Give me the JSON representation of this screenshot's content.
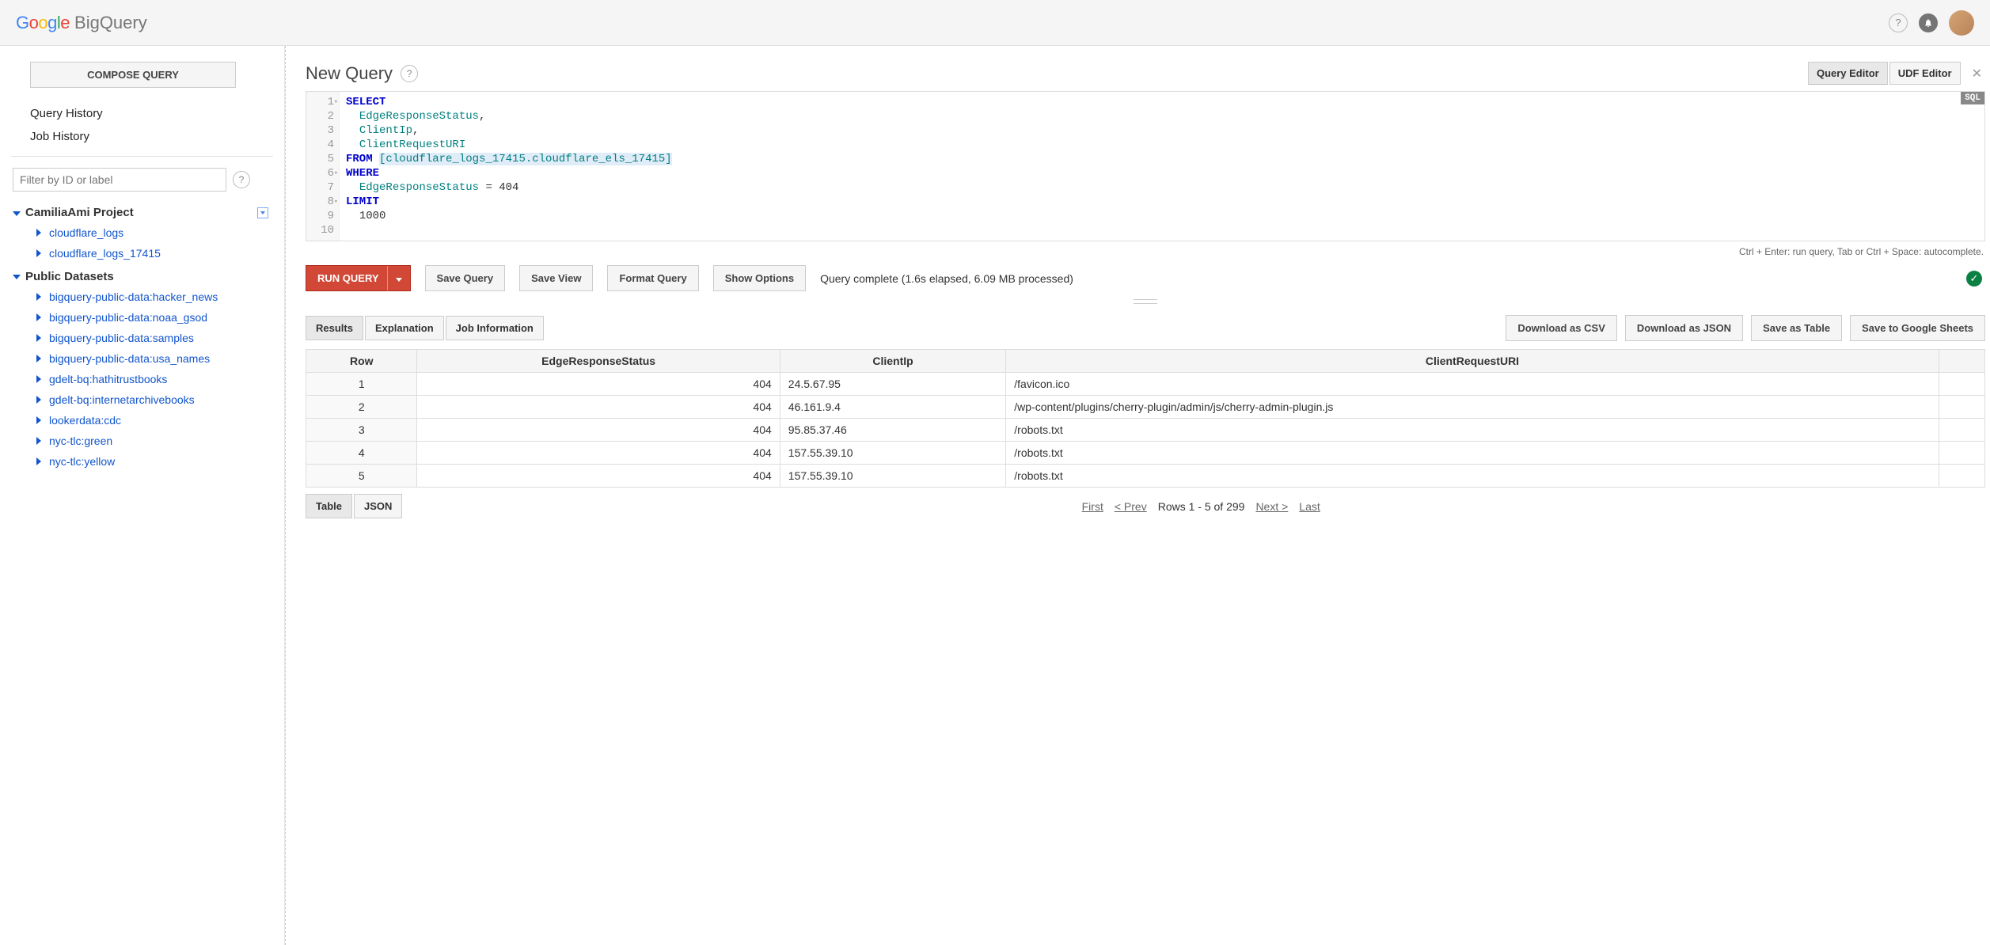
{
  "header": {
    "logo_google": "Google",
    "logo_bq": "BigQuery"
  },
  "sidebar": {
    "compose_label": "COMPOSE QUERY",
    "query_history": "Query History",
    "job_history": "Job History",
    "filter_placeholder": "Filter by ID or label",
    "project_name": "CamiliaAmi Project",
    "project_datasets": [
      {
        "label": "cloudflare_logs"
      },
      {
        "label": "cloudflare_logs_17415"
      }
    ],
    "public_label": "Public Datasets",
    "public_datasets": [
      {
        "label": "bigquery-public-data:hacker_news"
      },
      {
        "label": "bigquery-public-data:noaa_gsod"
      },
      {
        "label": "bigquery-public-data:samples"
      },
      {
        "label": "bigquery-public-data:usa_names"
      },
      {
        "label": "gdelt-bq:hathitrustbooks"
      },
      {
        "label": "gdelt-bq:internetarchivebooks"
      },
      {
        "label": "lookerdata:cdc"
      },
      {
        "label": "nyc-tlc:green"
      },
      {
        "label": "nyc-tlc:yellow"
      }
    ]
  },
  "query": {
    "title": "New Query",
    "tab_query_editor": "Query Editor",
    "tab_udf_editor": "UDF Editor",
    "sql_badge": "SQL",
    "lines": {
      "l1_kw": "SELECT",
      "l2_id": "EdgeResponseStatus",
      "l2_comma": ",",
      "l3_id": "ClientIp",
      "l3_comma": ",",
      "l4_id": "ClientRequestURI",
      "l5_kw": "FROM",
      "l5_tbl": "[cloudflare_logs_17415.cloudflare_els_17415]",
      "l6_kw": "WHERE",
      "l7_id": "EdgeResponseStatus",
      "l7_op": " = 404",
      "l8_kw": "LIMIT",
      "l9_val": "1000"
    },
    "hint": "Ctrl + Enter: run query, Tab or Ctrl + Space: autocomplete."
  },
  "actions": {
    "run": "RUN QUERY",
    "save_query": "Save Query",
    "save_view": "Save View",
    "format_query": "Format Query",
    "show_options": "Show Options",
    "status": "Query complete (1.6s elapsed, 6.09 MB processed)"
  },
  "results": {
    "tabs": {
      "results": "Results",
      "explanation": "Explanation",
      "job_info": "Job Information"
    },
    "exports": {
      "csv": "Download as CSV",
      "json": "Download as JSON",
      "save_table": "Save as Table",
      "save_sheets": "Save to Google Sheets"
    },
    "columns": [
      "Row",
      "EdgeResponseStatus",
      "ClientIp",
      "ClientRequestURI"
    ],
    "rows": [
      {
        "row": "1",
        "status": "404",
        "ip": "24.5.67.95",
        "uri": "/favicon.ico"
      },
      {
        "row": "2",
        "status": "404",
        "ip": "46.161.9.4",
        "uri": "/wp-content/plugins/cherry-plugin/admin/js/cherry-admin-plugin.js"
      },
      {
        "row": "3",
        "status": "404",
        "ip": "95.85.37.46",
        "uri": "/robots.txt"
      },
      {
        "row": "4",
        "status": "404",
        "ip": "157.55.39.10",
        "uri": "/robots.txt"
      },
      {
        "row": "5",
        "status": "404",
        "ip": "157.55.39.10",
        "uri": "/robots.txt"
      }
    ],
    "pager": {
      "table_tab": "Table",
      "json_tab": "JSON",
      "first": "First",
      "prev": "< Prev",
      "range": "Rows 1 - 5 of 299",
      "next": "Next >",
      "last": "Last"
    }
  }
}
